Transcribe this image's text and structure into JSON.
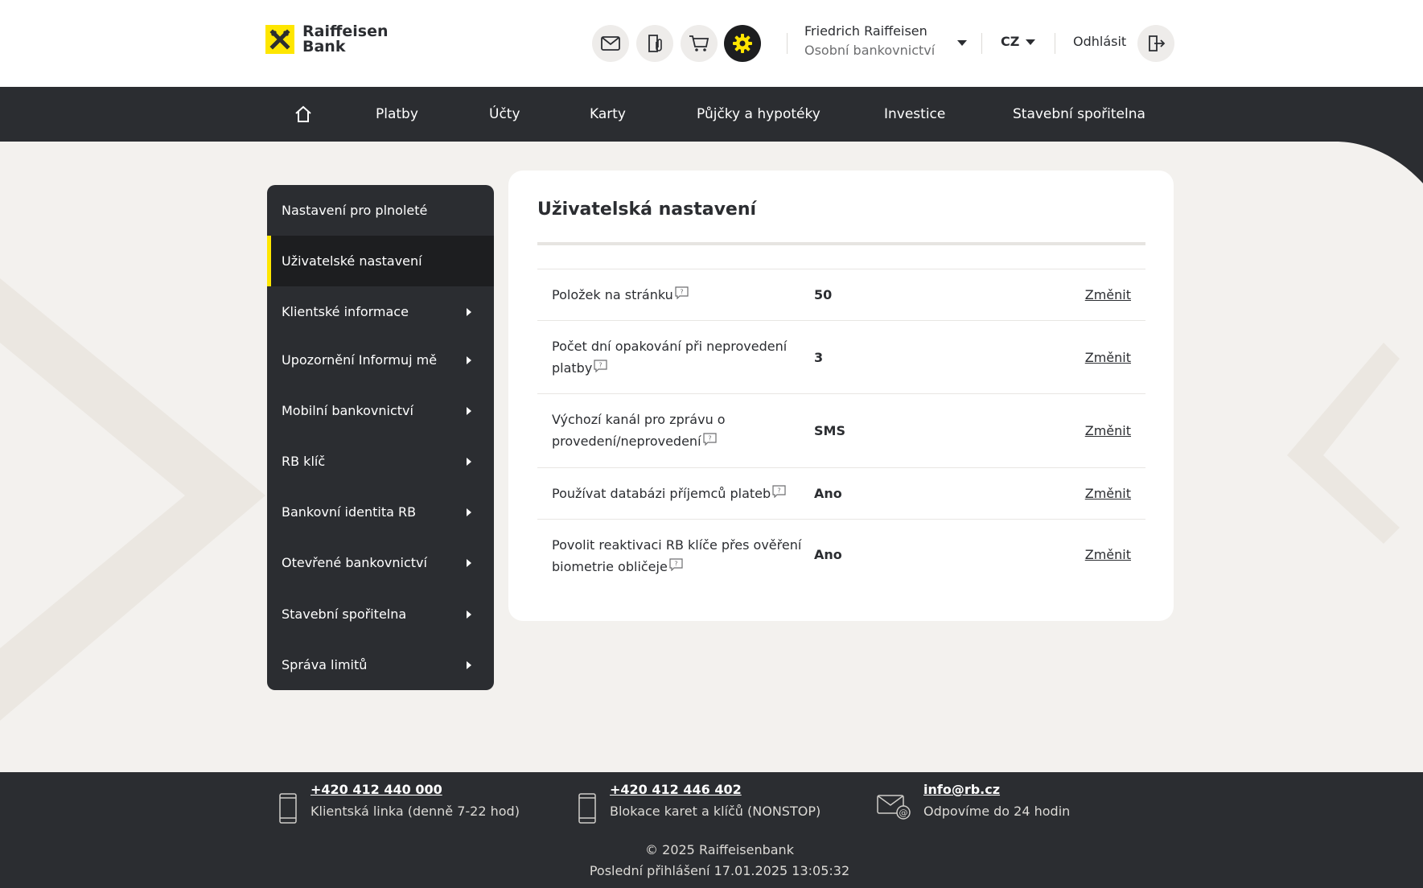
{
  "brand": {
    "name_line1": "Raiffeisen",
    "name_line2": "Bank",
    "accent_color": "#fee600",
    "dark_color": "#2b2d31"
  },
  "header": {
    "icons": [
      "mail-icon",
      "documents-icon",
      "cart-icon",
      "settings-icon"
    ],
    "user_name": "Friedrich Raiffeisen",
    "user_role": "Osobní bankovnictví",
    "language": "CZ",
    "logout_label": "Odhlásit"
  },
  "nav": {
    "home_icon": "home-icon",
    "items": [
      "Platby",
      "Účty",
      "Karty",
      "Půjčky a hypotéky",
      "Investice",
      "Stavební spořitelna"
    ]
  },
  "sidebar": {
    "items": [
      {
        "label": "Nastavení pro plnoleté",
        "expandable": false
      },
      {
        "label": "Uživatelské nastavení",
        "expandable": false,
        "active": true
      },
      {
        "label": "Klientské informace",
        "expandable": true
      },
      {
        "label": "Upozornění Informuj mě",
        "expandable": true
      },
      {
        "label": "Mobilní bankovnictví",
        "expandable": true
      },
      {
        "label": "RB klíč",
        "expandable": true
      },
      {
        "label": "Bankovní identita RB",
        "expandable": true
      },
      {
        "label": "Otevřené bankovnictví",
        "expandable": true
      },
      {
        "label": "Stavební spořitelna",
        "expandable": true
      },
      {
        "label": "Správa limitů",
        "expandable": true
      }
    ]
  },
  "main": {
    "title": "Uživatelská nastavení",
    "settings": [
      {
        "label_l1": "Položek na stránku",
        "label_l2": "",
        "value": "50",
        "action": "Změnit"
      },
      {
        "label_l1": "Počet dní opakování při neprovedení",
        "label_l2": "platby",
        "value": "3",
        "action": "Změnit"
      },
      {
        "label_l1": "Výchozí kanál pro zprávu o",
        "label_l2": "provedení/neprovedení",
        "value": "SMS",
        "action": "Změnit"
      },
      {
        "label_l1": "Používat databázi příjemců plateb",
        "label_l2": "",
        "value": "Ano",
        "action": "Změnit"
      },
      {
        "label_l1": "Povolit reaktivaci RB klíče přes ověření",
        "label_l2": "biometrie obličeje",
        "value": "Ano",
        "action": "Změnit"
      }
    ]
  },
  "footer": {
    "contacts": [
      {
        "icon": "phone-icon",
        "link": "+420 412 440 000",
        "sub": "Klientská linka (denně 7-22 hod)"
      },
      {
        "icon": "phone-icon",
        "link": "+420 412 446 402",
        "sub": "Blokace karet a klíčů (NONSTOP)"
      },
      {
        "icon": "mail-at-icon",
        "link": "info@rb.cz",
        "sub": "Odpovíme do 24 hodin"
      }
    ],
    "copyright": "© 2025 Raiffeisenbank",
    "last_login": "Poslední přihlášení 17.01.2025  13:05:32"
  }
}
